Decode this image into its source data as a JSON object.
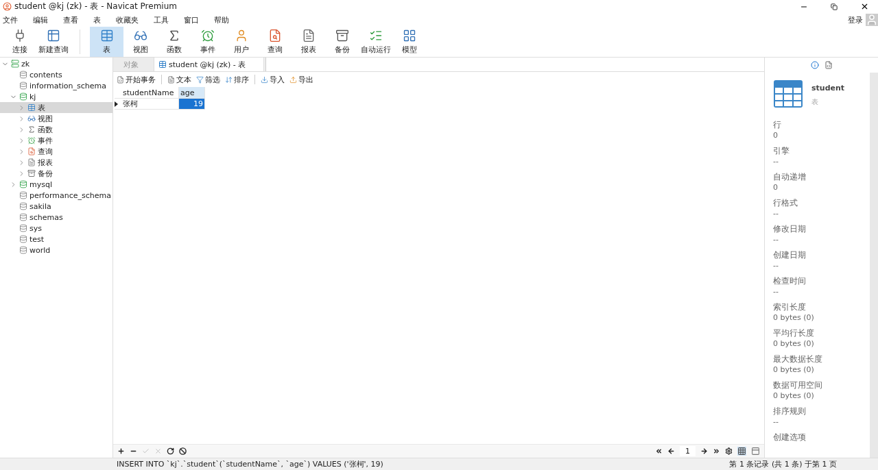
{
  "window": {
    "title": "student @kj (zk) - 表 - Navicat Premium"
  },
  "menu": [
    "文件",
    "编辑",
    "查看",
    "表",
    "收藏夹",
    "工具",
    "窗口",
    "帮助"
  ],
  "account": {
    "label": "登录"
  },
  "toolbar": [
    {
      "label": "连接",
      "kind": "plug",
      "selected": false
    },
    {
      "label": "新建查询",
      "kind": "newquery",
      "selected": false
    },
    {
      "label": "表",
      "kind": "table",
      "selected": true
    },
    {
      "label": "视图",
      "kind": "view",
      "selected": false
    },
    {
      "label": "函数",
      "kind": "function",
      "selected": false
    },
    {
      "label": "事件",
      "kind": "event",
      "selected": false
    },
    {
      "label": "用户",
      "kind": "user",
      "selected": false
    },
    {
      "label": "查询",
      "kind": "query",
      "selected": false
    },
    {
      "label": "报表",
      "kind": "report",
      "selected": false
    },
    {
      "label": "备份",
      "kind": "backup",
      "selected": false
    },
    {
      "label": "自动运行",
      "kind": "auto",
      "selected": false
    },
    {
      "label": "模型",
      "kind": "model",
      "selected": false
    }
  ],
  "tree": [
    {
      "label": "zk",
      "kind": "connection",
      "expanded": true,
      "selected": false,
      "children": [
        {
          "label": "contents",
          "kind": "db",
          "selected": false
        },
        {
          "label": "information_schema",
          "kind": "db",
          "selected": false
        },
        {
          "label": "kj",
          "kind": "opendb",
          "expanded": true,
          "selected": false,
          "children": [
            {
              "label": "表",
              "kind": "table",
              "expanded": false,
              "selected": true
            },
            {
              "label": "视图",
              "kind": "view",
              "expanded": false,
              "selected": false
            },
            {
              "label": "函数",
              "kind": "function",
              "expanded": false,
              "selected": false
            },
            {
              "label": "事件",
              "kind": "event",
              "expanded": false,
              "selected": false
            },
            {
              "label": "查询",
              "kind": "query",
              "expanded": false,
              "selected": false
            },
            {
              "label": "报表",
              "kind": "report",
              "expanded": false,
              "selected": false
            },
            {
              "label": "备份",
              "kind": "backup",
              "expanded": false,
              "selected": false
            }
          ]
        },
        {
          "label": "mysql",
          "kind": "opendb",
          "expanded": false,
          "selected": false
        },
        {
          "label": "performance_schema",
          "kind": "db",
          "selected": false
        },
        {
          "label": "sakila",
          "kind": "db",
          "selected": false
        },
        {
          "label": "schemas",
          "kind": "db",
          "selected": false
        },
        {
          "label": "sys",
          "kind": "db",
          "selected": false
        },
        {
          "label": "test",
          "kind": "db",
          "selected": false
        },
        {
          "label": "world",
          "kind": "db",
          "selected": false
        }
      ]
    }
  ],
  "tabs": [
    {
      "label": "对象",
      "selected": false
    },
    {
      "label": "student @kj (zk) - 表",
      "selected": true
    }
  ],
  "actions": [
    {
      "label": "开始事务",
      "kind": "transaction"
    },
    {
      "label": "文本",
      "kind": "text"
    },
    {
      "label": "筛选",
      "kind": "filter"
    },
    {
      "label": "排序",
      "kind": "sort"
    },
    {
      "label": "导入",
      "kind": "import"
    },
    {
      "label": "导出",
      "kind": "export"
    }
  ],
  "grid": {
    "columns": [
      "studentName",
      "age"
    ],
    "rows": [
      {
        "current": true,
        "cells": [
          {
            "text": "张柯",
            "selected": false
          },
          {
            "text": "19",
            "selected": true
          }
        ]
      }
    ]
  },
  "pager": {
    "page": "1"
  },
  "info": {
    "name": "student",
    "type": "表",
    "fields": [
      {
        "label": "行",
        "value": "0"
      },
      {
        "label": "引擎",
        "value": "--"
      },
      {
        "label": "自动递增",
        "value": "0"
      },
      {
        "label": "行格式",
        "value": "--"
      },
      {
        "label": "修改日期",
        "value": "--"
      },
      {
        "label": "创建日期",
        "value": "--"
      },
      {
        "label": "检查时间",
        "value": "--"
      },
      {
        "label": "索引长度",
        "value": "0 bytes (0)"
      },
      {
        "label": "平均行长度",
        "value": "0 bytes (0)"
      },
      {
        "label": "最大数据长度",
        "value": "0 bytes (0)"
      },
      {
        "label": "数据可用空间",
        "value": "0 bytes (0)"
      },
      {
        "label": "排序规则",
        "value": "--"
      },
      {
        "label": "创建选项"
      }
    ]
  },
  "status": {
    "sql": "INSERT INTO `kj`.`student`(`studentName`, `age`) VALUES ('张柯', 19)",
    "records": "第 1 条记录 (共 1 条) 于第 1 页"
  }
}
